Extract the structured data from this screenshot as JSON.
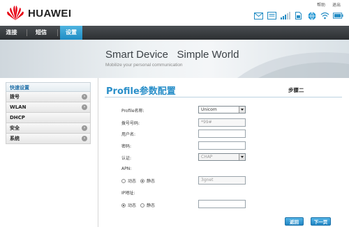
{
  "header": {
    "brand": "HUAWEI",
    "links": [
      "帮助",
      "退出"
    ],
    "status_icons": [
      "envelope-icon",
      "sms-icon",
      "signal-icon",
      "sim-icon",
      "globe-icon",
      "wifi-icon",
      "battery-icon"
    ]
  },
  "nav": {
    "tabs": [
      {
        "label": "连接",
        "active": false
      },
      {
        "label": "短信",
        "active": false
      },
      {
        "label": "设置",
        "active": true
      }
    ]
  },
  "banner": {
    "title": "Smart Device   Simple World",
    "subtitle": "Mobilize your personal communication"
  },
  "sidebar": {
    "header": "快速设置",
    "items": [
      {
        "label": "拨号"
      },
      {
        "label": "WLAN"
      },
      {
        "label": "DHCP"
      },
      {
        "label": "安全"
      },
      {
        "label": "系统"
      }
    ]
  },
  "main": {
    "title": "Profile参数配置",
    "step": "步骤二",
    "profile_label": "Profile名称:",
    "profile_value": "Unicom",
    "dial_label": "拨号号码:",
    "dial_value": "*99#",
    "user_label": "用户名:",
    "user_value": "",
    "password_label": "密码:",
    "password_value": "",
    "auth_label": "认证:",
    "auth_value": "CHAP",
    "apn_label": "APN:",
    "apn_dynamic": "动态",
    "apn_static": "静态",
    "apn_value": "3gnet",
    "ip_label": "IP地址:",
    "ip_dynamic": "动态",
    "ip_static": "静态",
    "ip_value": ""
  },
  "buttons": {
    "back": "返回",
    "next": "下一页"
  },
  "colors": {
    "accent": "#2a8fc9",
    "nav_active": "#2d9bd4",
    "brand_red": "#e60012"
  }
}
